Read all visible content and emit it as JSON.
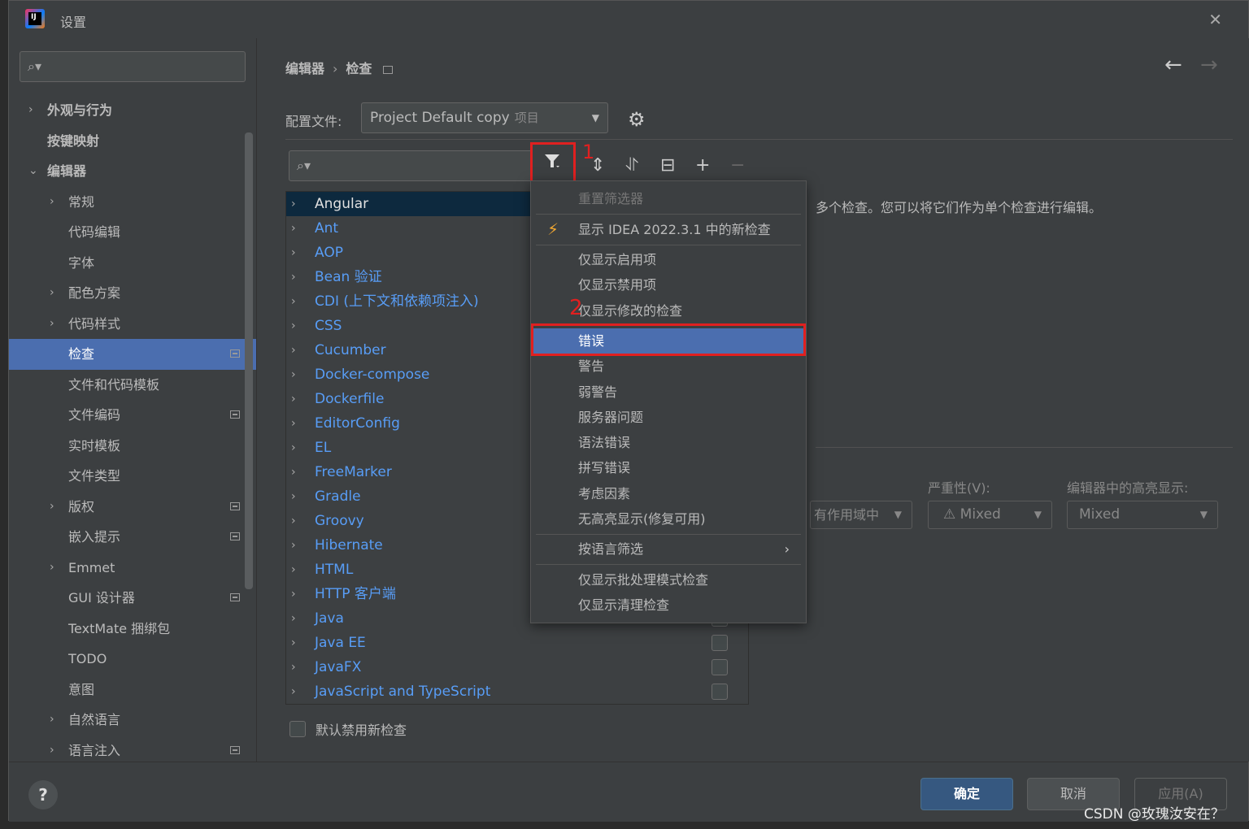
{
  "window": {
    "title": "设置",
    "app_icon": "intellij-idea-icon"
  },
  "sidebar": {
    "search_placeholder": "",
    "items": [
      {
        "label": "外观与行为",
        "expand": "›",
        "level": 0,
        "bold": true
      },
      {
        "label": "按键映射",
        "expand": "",
        "level": 0,
        "bold": true
      },
      {
        "label": "编辑器",
        "expand": "⌄",
        "level": 0,
        "bold": true
      },
      {
        "label": "常规",
        "expand": "›",
        "level": 1
      },
      {
        "label": "代码编辑",
        "expand": "",
        "level": 1
      },
      {
        "label": "字体",
        "expand": "",
        "level": 1
      },
      {
        "label": "配色方案",
        "expand": "›",
        "level": 1
      },
      {
        "label": "代码样式",
        "expand": "›",
        "level": 1
      },
      {
        "label": "检查",
        "expand": "",
        "level": 1,
        "selected": true,
        "project": true
      },
      {
        "label": "文件和代码模板",
        "expand": "",
        "level": 1
      },
      {
        "label": "文件编码",
        "expand": "",
        "level": 1,
        "project": true
      },
      {
        "label": "实时模板",
        "expand": "",
        "level": 1
      },
      {
        "label": "文件类型",
        "expand": "",
        "level": 1
      },
      {
        "label": "版权",
        "expand": "›",
        "level": 1,
        "project": true
      },
      {
        "label": "嵌入提示",
        "expand": "",
        "level": 1,
        "project": true
      },
      {
        "label": "Emmet",
        "expand": "›",
        "level": 1
      },
      {
        "label": "GUI 设计器",
        "expand": "",
        "level": 1,
        "project": true
      },
      {
        "label": "TextMate 捆绑包",
        "expand": "",
        "level": 1
      },
      {
        "label": "TODO",
        "expand": "",
        "level": 1
      },
      {
        "label": "意图",
        "expand": "",
        "level": 1
      },
      {
        "label": "自然语言",
        "expand": "›",
        "level": 1
      },
      {
        "label": "语言注入",
        "expand": "›",
        "level": 1,
        "project": true
      }
    ]
  },
  "breadcrumb": {
    "parent": "编辑器",
    "separator": "›",
    "current": "检查"
  },
  "profile": {
    "label": "配置文件:",
    "value": "Project Default copy",
    "scope": "项目"
  },
  "inspections": [
    {
      "label": "Angular",
      "selected": true
    },
    {
      "label": "Ant"
    },
    {
      "label": "AOP"
    },
    {
      "label": "Bean 验证"
    },
    {
      "label": "CDI (上下文和依赖项注入)"
    },
    {
      "label": "CSS"
    },
    {
      "label": "Cucumber"
    },
    {
      "label": "Docker-compose"
    },
    {
      "label": "Dockerfile"
    },
    {
      "label": "EditorConfig"
    },
    {
      "label": "EL"
    },
    {
      "label": "FreeMarker"
    },
    {
      "label": "Gradle"
    },
    {
      "label": "Groovy"
    },
    {
      "label": "Hibernate"
    },
    {
      "label": "HTML"
    },
    {
      "label": "HTTP 客户端"
    },
    {
      "label": "Java",
      "checkbox": true
    },
    {
      "label": "Java EE",
      "checkbox": true
    },
    {
      "label": "JavaFX",
      "checkbox": true
    },
    {
      "label": "JavaScript and TypeScript",
      "checkbox": true
    }
  ],
  "description": "多个检查。您可以将它们作为单个检查进行编辑。",
  "options": {
    "scope_value": "有作用域中",
    "severity_label": "严重性(V):",
    "severity_value": "Mixed",
    "highlight_label": "编辑器中的高亮显示:",
    "highlight_value": "Mixed"
  },
  "default_disable_label": "默认禁用新检查",
  "filter_menu": {
    "reset": "重置筛选器",
    "show_new": "显示 IDEA 2022.3.1 中的新检查",
    "enabled_only": "仅显示启用项",
    "disabled_only": "仅显示禁用项",
    "modified_only": "仅显示修改的检查",
    "error": "错误",
    "warning": "警告",
    "weak_warning": "弱警告",
    "server_problem": "服务器问题",
    "grammar_error": "语法错误",
    "typo": "拼写错误",
    "consideration": "考虑因素",
    "no_highlight": "无高亮显示(修复可用)",
    "by_language": "按语言筛选",
    "batch_only": "仅显示批处理模式检查",
    "cleanup_only": "仅显示清理检查"
  },
  "annotations": {
    "one": "1",
    "two": "2"
  },
  "footer": {
    "help": "?",
    "ok": "确定",
    "cancel": "取消",
    "apply": "应用(A)"
  },
  "watermark": "CSDN @玫瑰汝安在？",
  "colors": {
    "accent": "#4b6eaf",
    "link": "#589df6",
    "highlight_box": "#e02020",
    "ok_button": "#365880"
  }
}
